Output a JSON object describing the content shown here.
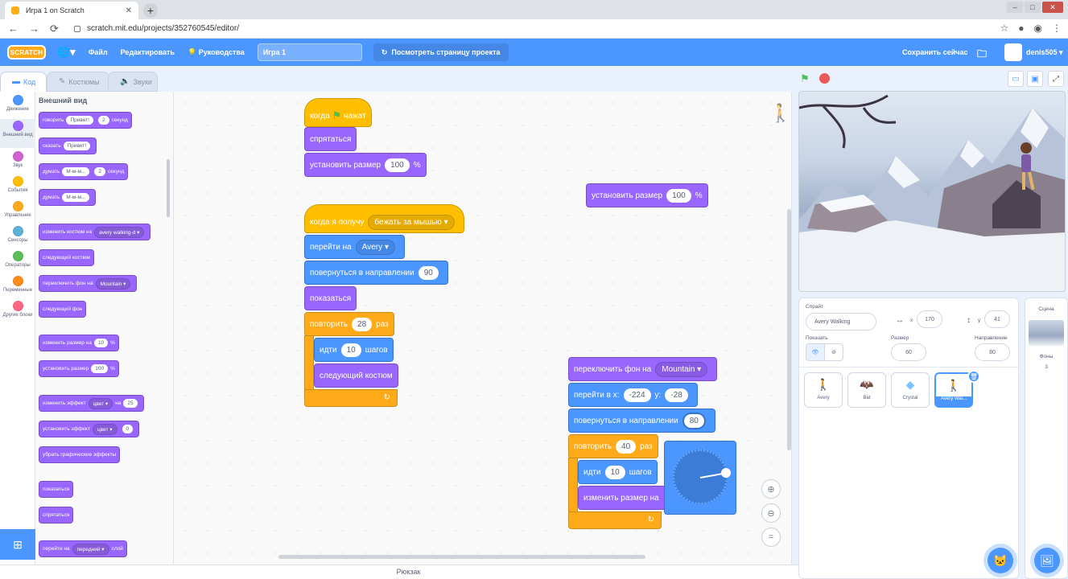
{
  "browser": {
    "tab_title": "Игра 1 on Scratch",
    "url": "scratch.mit.edu/projects/352760545/editor/"
  },
  "menubar": {
    "logo": "SCRATCH",
    "file": "Файл",
    "edit": "Редактировать",
    "tutorials": "Руководства",
    "project_title": "Игра 1",
    "see_project": "Посмотреть страницу проекта",
    "save_now": "Сохранить сейчас",
    "username": "denis505"
  },
  "editor_tabs": [
    "Код",
    "Костюмы",
    "Звуки"
  ],
  "categories": [
    {
      "label": "Движение",
      "color": "#4c97ff"
    },
    {
      "label": "Внешний вид",
      "color": "#9966ff"
    },
    {
      "label": "Звук",
      "color": "#cf63cf"
    },
    {
      "label": "События",
      "color": "#ffbf00"
    },
    {
      "label": "Управление",
      "color": "#ffab19"
    },
    {
      "label": "Сенсоры",
      "color": "#5cb1d6"
    },
    {
      "label": "Операторы",
      "color": "#59c059"
    },
    {
      "label": "Переменные",
      "color": "#ff8c1a"
    },
    {
      "label": "Другие блоки",
      "color": "#ff6680"
    }
  ],
  "palette": {
    "title": "Внешний вид",
    "say_secs": {
      "a": "говорить",
      "b": "Привет!",
      "c": "2",
      "d": "секунд"
    },
    "say": {
      "a": "сказать",
      "b": "Привет!"
    },
    "think_secs": {
      "a": "думать",
      "b": "М-м-м...",
      "c": "2",
      "d": "секунд"
    },
    "think": {
      "a": "думать",
      "b": "М-м-м..."
    },
    "switch_costume": {
      "a": "изменить костюм на",
      "b": "avery walking-d"
    },
    "next_costume": "следующий костюм",
    "switch_backdrop": {
      "a": "переключить фон на",
      "b": "Mountain"
    },
    "next_backdrop": "следующий фон",
    "change_size": {
      "a": "изменить размер на",
      "b": "10",
      "c": "%"
    },
    "set_size": {
      "a": "установить размер",
      "b": "100",
      "c": "%"
    },
    "change_effect": {
      "a": "изменить эффект",
      "b": "цвет",
      "c": "на",
      "d": "25"
    },
    "set_effect": {
      "a": "установить эффект",
      "b": "цвет",
      "c": "0"
    },
    "clear_effects": "убрать графические эффекты",
    "show": "показаться",
    "hide": "спрятаться",
    "go_layer": {
      "a": "перейти на",
      "b": "передний",
      "c": "слой"
    }
  },
  "script1": {
    "hat": "когда",
    "hat2": "нажат",
    "hide": "спрятаться",
    "set_size": "установить размер",
    "set_size_val": "100",
    "pct": "%"
  },
  "script2": {
    "hat": "когда я получу",
    "msg": "бежать за мышью",
    "goto": "перейти на",
    "goto_val": "Avery",
    "point": "повернуться в направлении",
    "point_val": "90",
    "show": "показаться",
    "repeat": "повторить",
    "repeat_val": "28",
    "times": "раз",
    "move": "идти",
    "move_val": "10",
    "steps": "шагов",
    "next_costume": "следующий костюм"
  },
  "loose_block": {
    "label": "установить размер",
    "val": "100",
    "pct": "%"
  },
  "script3": {
    "switch_backdrop": "переключить фон на",
    "backdrop_val": "Mountain",
    "goto_xy": "перейти в x:",
    "x_val": "-224",
    "y_lbl": "y:",
    "y_val": "-28",
    "point": "повернуться в направлении",
    "point_val": "80",
    "repeat": "повторить",
    "repeat_val": "40",
    "times": "раз",
    "move": "идти",
    "move_val": "10",
    "steps": "шагов",
    "change_size": "изменить размер на"
  },
  "backpack": "Рюкзак",
  "sprite_info": {
    "sprite_label": "Спрайт",
    "sprite_name": "Avery Walking",
    "x_label": "x",
    "x_val": "170",
    "y_label": "y",
    "y_val": "41",
    "show_label": "Показать",
    "size_label": "Размер",
    "size_val": "60",
    "direction_label": "Направление",
    "direction_val": "80"
  },
  "sprites": [
    "Avery",
    "Bat",
    "Crystal",
    "Avery Wal..."
  ],
  "scene": {
    "label": "Сцена",
    "backdrops_label": "Фоны",
    "backdrops_count": "3"
  }
}
